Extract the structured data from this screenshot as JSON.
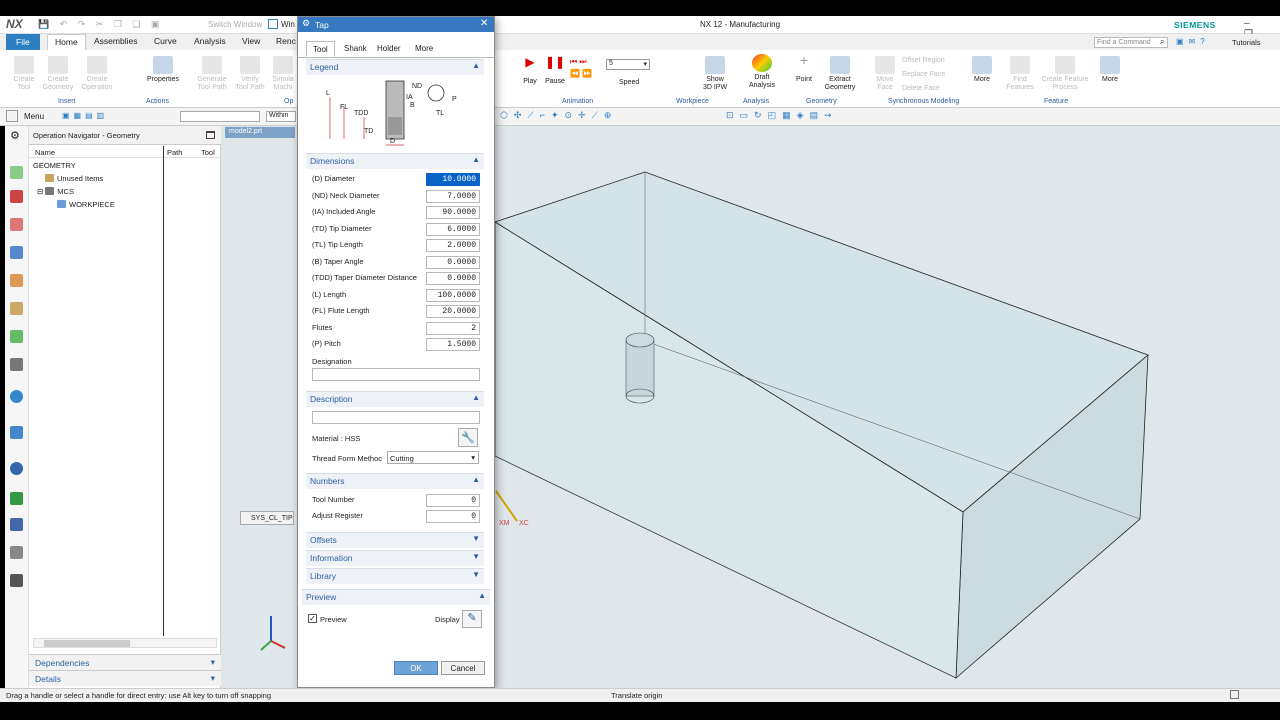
{
  "app": {
    "logo": "NX",
    "title": "NX 12 - Manufacturing",
    "brand": "SIEMENS",
    "window_controls": "– ❐ ✕",
    "quick_access_hidden_label": "Switch Window",
    "quick_access_window_label": "Win"
  },
  "ribbon_tabs": [
    {
      "label": "File"
    },
    {
      "label": "Home"
    },
    {
      "label": "Assemblies"
    },
    {
      "label": "Curve"
    },
    {
      "label": "Analysis"
    },
    {
      "label": "View"
    },
    {
      "label": "Renc"
    }
  ],
  "ribbon_right": {
    "search_placeholder": "Find a Command",
    "tutorials": "Tutorials"
  },
  "ribbon_left": {
    "buttons": [
      {
        "label": "Create\nTool"
      },
      {
        "label": "Create\nGeometry"
      },
      {
        "label": "Create\nOperation"
      },
      {
        "label": "Properties"
      },
      {
        "label": "Generate\nTool Path"
      },
      {
        "label": "Verify\nTool Path"
      },
      {
        "label": "Simula\nMachi"
      }
    ],
    "groups": [
      {
        "label": "Insert"
      },
      {
        "label": "Actions"
      },
      {
        "label": "Op"
      }
    ]
  },
  "ribbon_main": {
    "buttons": [
      {
        "label": "Play"
      },
      {
        "label": "Pause"
      },
      {
        "label": "Speed"
      },
      {
        "label": "Show\n3D IPW"
      },
      {
        "label": "Draft\nAnalysis"
      },
      {
        "label": "Point"
      },
      {
        "label": "Extract\nGeometry"
      },
      {
        "label": "Move\nFace"
      },
      {
        "label": "More"
      },
      {
        "label": "Find\nFeatures"
      },
      {
        "label": "Create Feature\nProcess"
      },
      {
        "label": "More"
      }
    ],
    "speed_value": "5",
    "sync_items": [
      {
        "label": "Offset Region"
      },
      {
        "label": "Replace Face"
      },
      {
        "label": "Delete Face"
      }
    ],
    "groups": [
      {
        "label": "Animation"
      },
      {
        "label": "Workpiece"
      },
      {
        "label": "Analysis"
      },
      {
        "label": "Geometry"
      },
      {
        "label": "Synchronous Modeling"
      },
      {
        "label": "Feature"
      }
    ]
  },
  "toolbar": {
    "menu_label": "Menu",
    "filter_scope": "Within"
  },
  "navigator": {
    "title": "Operation Navigator - Geometry",
    "columns": [
      {
        "label": "Name"
      },
      {
        "label": "Path"
      },
      {
        "label": "Tool"
      }
    ],
    "tree": [
      {
        "label": "GEOMETRY"
      },
      {
        "label": "Unused Items"
      },
      {
        "label": "MCS"
      },
      {
        "label": "WORKPIECE"
      }
    ],
    "footer": [
      {
        "label": "Dependencies"
      },
      {
        "label": "Details"
      }
    ]
  },
  "graphics": {
    "part_tab": "model2.prt",
    "tooltip": "SYS_CL_TIP",
    "triad_labels": [
      "XM",
      "XC"
    ]
  },
  "dialog": {
    "title": "Tap",
    "tabs": [
      {
        "label": "Tool"
      },
      {
        "label": "Shank"
      },
      {
        "label": "Holder"
      },
      {
        "label": "More"
      }
    ],
    "legend_title": "Legend",
    "legend_labels": {
      "nd": "ND",
      "ia": "IA",
      "b": "B",
      "fl": "FL",
      "tdd": "TDD",
      "l": "L",
      "p": "P",
      "tl": "TL",
      "td": "TD",
      "d": "D"
    },
    "dimensions_title": "Dimensions",
    "dimensions": [
      {
        "label": "(D) Diameter",
        "value": "10.0000"
      },
      {
        "label": "(ND) Neck Diameter",
        "value": "7.0000"
      },
      {
        "label": "(IA) Included Angle",
        "value": "90.0000"
      },
      {
        "label": "(TD) Tip Diameter",
        "value": "6.0000"
      },
      {
        "label": "(TL) Tip Length",
        "value": "2.0000"
      },
      {
        "label": "(B) Taper Angle",
        "value": "0.0000"
      },
      {
        "label": "(TDD) Taper Diameter Distance",
        "value": "0.0000"
      },
      {
        "label": "(L) Length",
        "value": "100.0000"
      },
      {
        "label": "(FL) Flute Length",
        "value": "20.0000"
      },
      {
        "label": "Flutes",
        "value": "2"
      },
      {
        "label": "(P) Pitch",
        "value": "1.5000"
      }
    ],
    "designation_label": "Designation",
    "designation_value": "",
    "description_title": "Description",
    "description_value": "",
    "material_label": "Material : HSS",
    "thread_form_label": "Thread Form Methoc",
    "thread_form_value": "Cutting",
    "numbers_title": "Numbers",
    "tool_number_label": "Tool Number",
    "tool_number_value": "0",
    "adjust_register_label": "Adjust Register",
    "adjust_register_value": "0",
    "collapsed_sections": [
      {
        "label": "Offsets"
      },
      {
        "label": "Information"
      },
      {
        "label": "Library"
      }
    ],
    "preview_title": "Preview",
    "preview_checkbox_label": "Preview",
    "preview_checked": true,
    "display_label": "Display",
    "ok_label": "OK",
    "cancel_label": "Cancel"
  },
  "status": {
    "left": "Drag a handle or select a handle for direct entry: use Alt key to turn off snapping",
    "center": "Translate origin"
  },
  "colors": {
    "accent": "#3679c0",
    "selection": "#0a64c8",
    "section_text": "#2b5fa1",
    "brand": "#009999",
    "viewport": "#dfe7ea"
  }
}
